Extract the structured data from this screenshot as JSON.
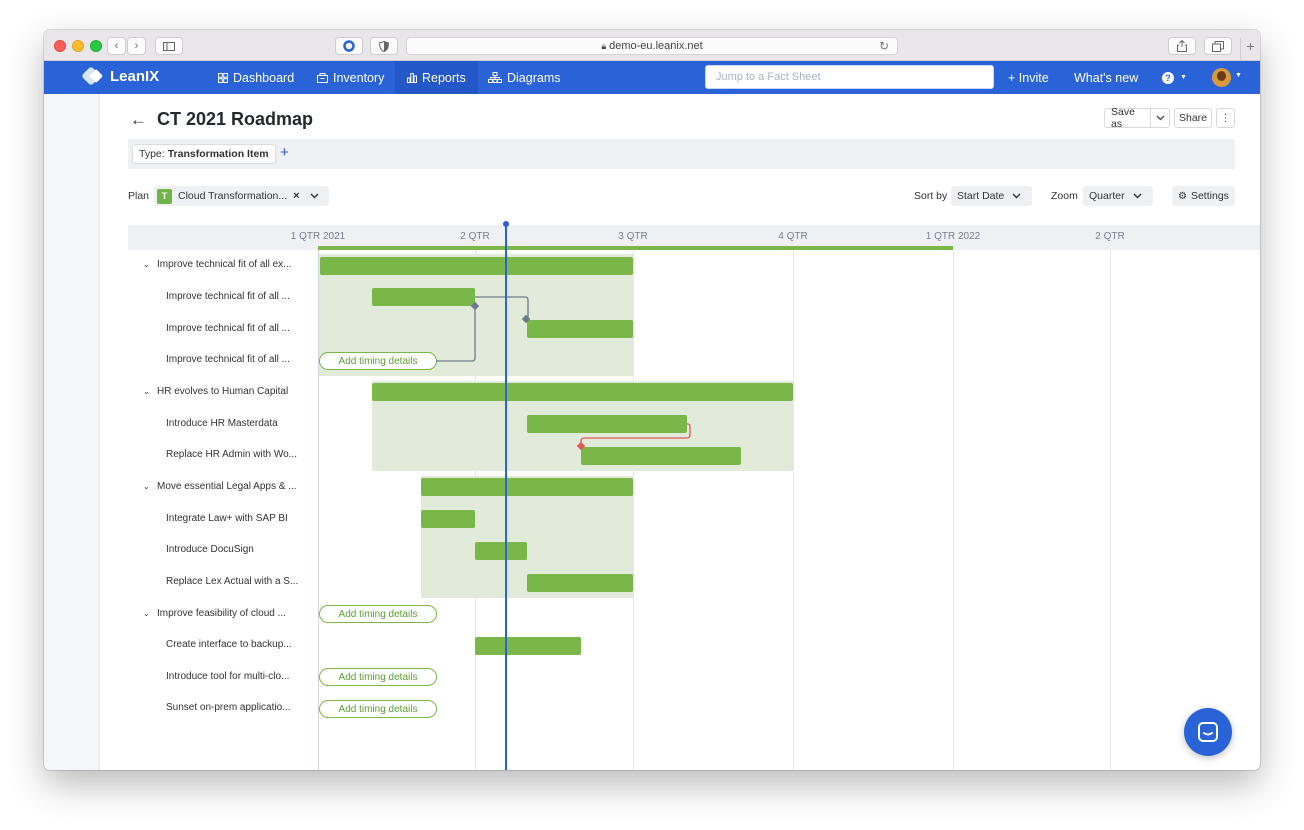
{
  "browser": {
    "url": "demo-eu.leanix.net"
  },
  "nav": {
    "brand": "LeanIX",
    "items": [
      {
        "label": "Dashboard",
        "icon": "grid-icon"
      },
      {
        "label": "Inventory",
        "icon": "inventory-icon"
      },
      {
        "label": "Reports",
        "icon": "bar-chart-icon"
      },
      {
        "label": "Diagrams",
        "icon": "diagram-icon"
      }
    ],
    "search_placeholder": "Jump to a Fact Sheet",
    "invite": "+ Invite",
    "whats_new": "What's new",
    "help": "?"
  },
  "page": {
    "title": "CT 2021 Roadmap",
    "save_as": "Save as",
    "share": "Share",
    "filter": {
      "key": "Type:",
      "value": "Transformation Item"
    },
    "plan_label": "Plan",
    "plan_badge": "T",
    "plan_value": "Cloud Transformation...",
    "sort_label": "Sort by",
    "sort_value": "Start Date",
    "zoom_label": "Zoom",
    "zoom_value": "Quarter",
    "settings": "Settings"
  },
  "gantt": {
    "ticks": [
      "1 QTR 2021",
      "2 QTR",
      "3 QTR",
      "4 QTR",
      "1 QTR 2022",
      "2 QTR"
    ],
    "add_timing_label": "Add timing details",
    "rows": [
      {
        "label": "Improve technical fit of all ex...",
        "group": true
      },
      {
        "label": "Improve technical fit of all ...",
        "group": false
      },
      {
        "label": "Improve technical fit of all ...",
        "group": false
      },
      {
        "label": "Improve technical fit of all ...",
        "group": false
      },
      {
        "label": "HR evolves to Human Capital",
        "group": true
      },
      {
        "label": "Introduce HR Masterdata",
        "group": false
      },
      {
        "label": "Replace HR Admin with Wo...",
        "group": false
      },
      {
        "label": "Move essential Legal Apps & ...",
        "group": true
      },
      {
        "label": "Integrate Law+ with SAP BI",
        "group": false
      },
      {
        "label": "Introduce DocuSign",
        "group": false
      },
      {
        "label": "Replace Lex Actual with a S...",
        "group": false
      },
      {
        "label": "Improve feasibility of cloud ...",
        "group": true
      },
      {
        "label": "Create interface to backup...",
        "group": false
      },
      {
        "label": "Introduce tool for multi-clo...",
        "group": false
      },
      {
        "label": "Sunset on-prem applicatio...",
        "group": false
      }
    ]
  },
  "colors": {
    "brand_blue": "#2a62d8",
    "bar_green": "#7ab648",
    "group_bg": "#e2ebd9",
    "dependency_grey": "#6b7a8c",
    "dependency_red": "#e05a5a"
  }
}
